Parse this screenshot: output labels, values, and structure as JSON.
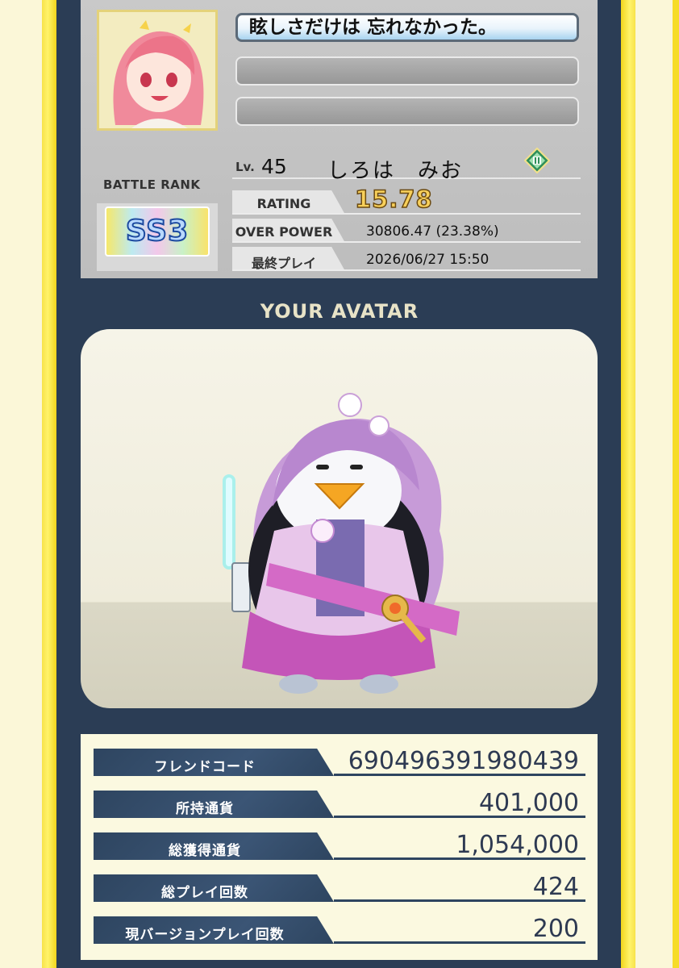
{
  "profile": {
    "comment": "眩しさだけは 忘れなかった。",
    "level_label": "Lv.",
    "level": "45",
    "name": "しろは　みお",
    "battle_rank_label": "BATTLE RANK",
    "battle_rank": "SS3",
    "stats": [
      {
        "label": "RATING",
        "value": "15.78"
      },
      {
        "label": "OVER POWER",
        "value": "30806.47 (23.38%)"
      },
      {
        "label": "最終プレイ",
        "value": "2026/06/27 15:50"
      }
    ]
  },
  "avatar": {
    "title": "YOUR AVATAR"
  },
  "info": [
    {
      "label": "フレンドコード",
      "value": "690496391980439"
    },
    {
      "label": "所持通貨",
      "value": "401,000"
    },
    {
      "label": "総獲得通貨",
      "value": "1,054,000"
    },
    {
      "label": "総プレイ回数",
      "value": "424"
    },
    {
      "label": "現バージョンプレイ回数",
      "value": "200"
    }
  ],
  "colors": {
    "panel": "#2b3d55",
    "frame_yellow": "#f7e24a",
    "rating_gold": "#f8d05a",
    "tag_navy": "#2e4560"
  },
  "icons": [
    "class-badge-icon",
    "character-portrait",
    "penguin-avatar"
  ]
}
